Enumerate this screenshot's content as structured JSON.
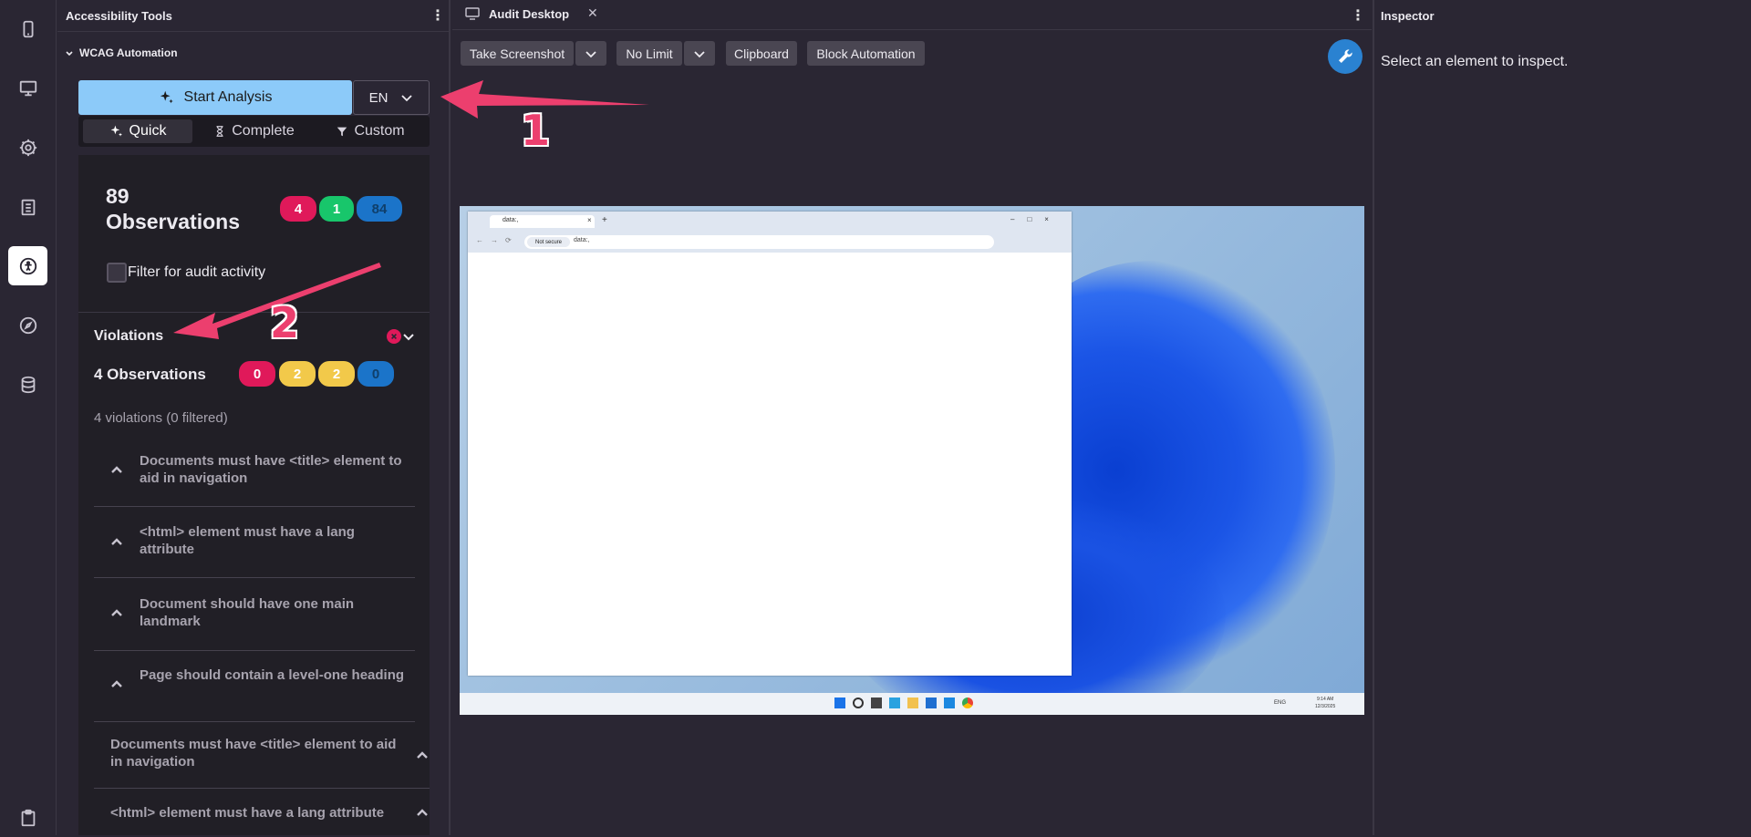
{
  "rail": {
    "items": [
      "mobile-icon",
      "desktop-icon",
      "settings-icon",
      "clipboard-list-icon",
      "accessibility-icon",
      "compass-icon",
      "database-icon",
      "clipboard-icon"
    ],
    "active": "accessibility-icon"
  },
  "a11y_panel": {
    "title": "Accessibility Tools",
    "section_title": "WCAG Automation",
    "start_label": "Start Analysis",
    "language": "EN",
    "modes": [
      "Quick",
      "Complete",
      "Custom"
    ],
    "selected_mode": "Quick",
    "summary": {
      "count": "89",
      "label": "Observations",
      "badges": [
        {
          "value": "4",
          "color": "#e0195a",
          "text_color": "#ffffff"
        },
        {
          "value": "1",
          "color": "#18c66b",
          "text_color": "#ffffff"
        },
        {
          "value": "84",
          "color": "#1b74c9",
          "text_color": "#0f3f6b"
        }
      ]
    },
    "filter_label": "Filter for audit activity",
    "violations": {
      "title": "Violations",
      "count_label": "4 Observations",
      "badges": [
        {
          "value": "0",
          "color": "#e0195a",
          "text_color": "#ffffff"
        },
        {
          "value": "2",
          "color": "#f2c94a",
          "text_color": "#ffffff"
        },
        {
          "value": "2",
          "color": "#f2c94a",
          "text_color": "#ffffff"
        },
        {
          "value": "0",
          "color": "#1b74c9",
          "text_color": "#0f3f6b"
        }
      ],
      "summary_text": "4 violations (0 filtered)",
      "items": [
        "Documents must have <title> element to aid in navigation",
        "<html> element must have a lang attribute",
        "Document should have one main landmark",
        "Page should contain a level-one heading"
      ],
      "expanded_items": [
        "Documents must have <title> element to aid in navigation",
        "<html> element must have a lang attribute"
      ]
    }
  },
  "audit_desktop": {
    "tab_title": "Audit Desktop",
    "toolbar": {
      "screenshot": "Take Screenshot",
      "limit": "No Limit",
      "clipboard": "Clipboard",
      "block": "Block Automation"
    },
    "screenshot": {
      "browser_tab_title": "data:,",
      "not_secure": "Not secure",
      "address": "data:,",
      "tray_lang": "ENG",
      "time": "9:14 AM",
      "date": "12/3/2025"
    }
  },
  "inspector": {
    "title": "Inspector",
    "placeholder": "Select an element to inspect."
  },
  "annotations": {
    "one": "1",
    "two": "2",
    "color": "#ec3f6e"
  }
}
